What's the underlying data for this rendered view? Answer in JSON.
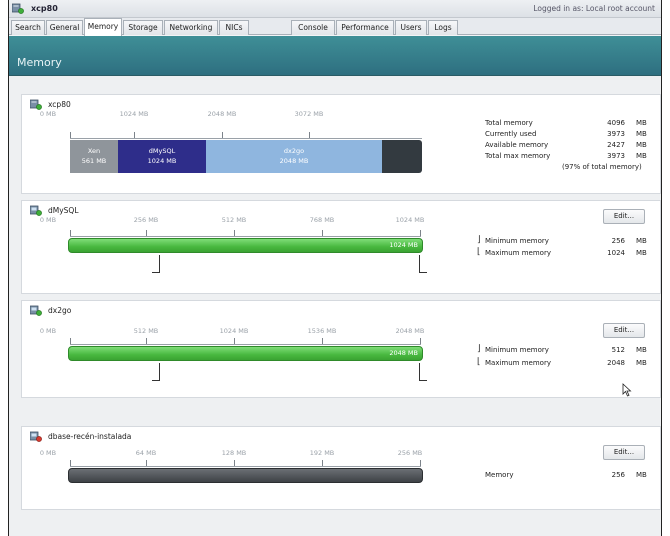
{
  "titlebar": {
    "host_name": "xcp80",
    "login_status": "Logged in as: Local root account"
  },
  "tabs": [
    {
      "label": "Search"
    },
    {
      "label": "General"
    },
    {
      "label": "Memory"
    },
    {
      "label": "Storage"
    },
    {
      "label": "Networking"
    },
    {
      "label": "NICs"
    },
    {
      "label": "Console"
    },
    {
      "label": "Performance"
    },
    {
      "label": "Users"
    },
    {
      "label": "Logs"
    }
  ],
  "active_tab": "Memory",
  "section": {
    "title": "Memory"
  },
  "host_panel": {
    "name": "xcp80",
    "ticks": [
      "0 MB",
      "1024 MB",
      "2048 MB",
      "3072 MB"
    ],
    "segments": [
      {
        "name": "Xen",
        "value": "561 MB",
        "mb": 561,
        "color": "#8f959b"
      },
      {
        "name": "dMySQL",
        "value": "1024 MB",
        "mb": 1024,
        "color": "#2e2d8a"
      },
      {
        "name": "dx2go",
        "value": "2048 MB",
        "mb": 2048,
        "color": "#8fb6df"
      }
    ],
    "total_mb": 4096,
    "stats": [
      {
        "label": "Total memory",
        "value": "4096",
        "unit": "MB"
      },
      {
        "label": "Currently used",
        "value": "3973",
        "unit": "MB"
      },
      {
        "label": "Available memory",
        "value": "2427",
        "unit": "MB"
      },
      {
        "label": "Total max memory",
        "value": "3973",
        "unit": "MB"
      }
    ],
    "note": "(97% of total memory)"
  },
  "vms": [
    {
      "name": "dMySQL",
      "ticks": [
        "0 MB",
        "256 MB",
        "512 MB",
        "768 MB",
        "1024 MB"
      ],
      "bar_label": "1024 MB",
      "bar_fraction": 1.0,
      "edit_label": "Edit...",
      "stats": [
        {
          "label": "Minimum memory",
          "value": "256",
          "unit": "MB"
        },
        {
          "label": "Maximum memory",
          "value": "1024",
          "unit": "MB"
        }
      ]
    },
    {
      "name": "dx2go",
      "ticks": [
        "0 MB",
        "512 MB",
        "1024 MB",
        "1536 MB",
        "2048 MB"
      ],
      "bar_label": "2048 MB",
      "bar_fraction": 1.0,
      "edit_label": "Edit...",
      "stats": [
        {
          "label": "Minimum memory",
          "value": "512",
          "unit": "MB"
        },
        {
          "label": "Maximum memory",
          "value": "2048",
          "unit": "MB"
        }
      ]
    },
    {
      "name": "dbase-recén-instalada",
      "ticks": [
        "0 MB",
        "64 MB",
        "128 MB",
        "192 MB",
        "256 MB"
      ],
      "bar_label": "",
      "bar_fraction": 1.0,
      "edit_label": "Edit...",
      "stats": [
        {
          "label": "Memory",
          "value": "256",
          "unit": "MB"
        }
      ]
    }
  ]
}
